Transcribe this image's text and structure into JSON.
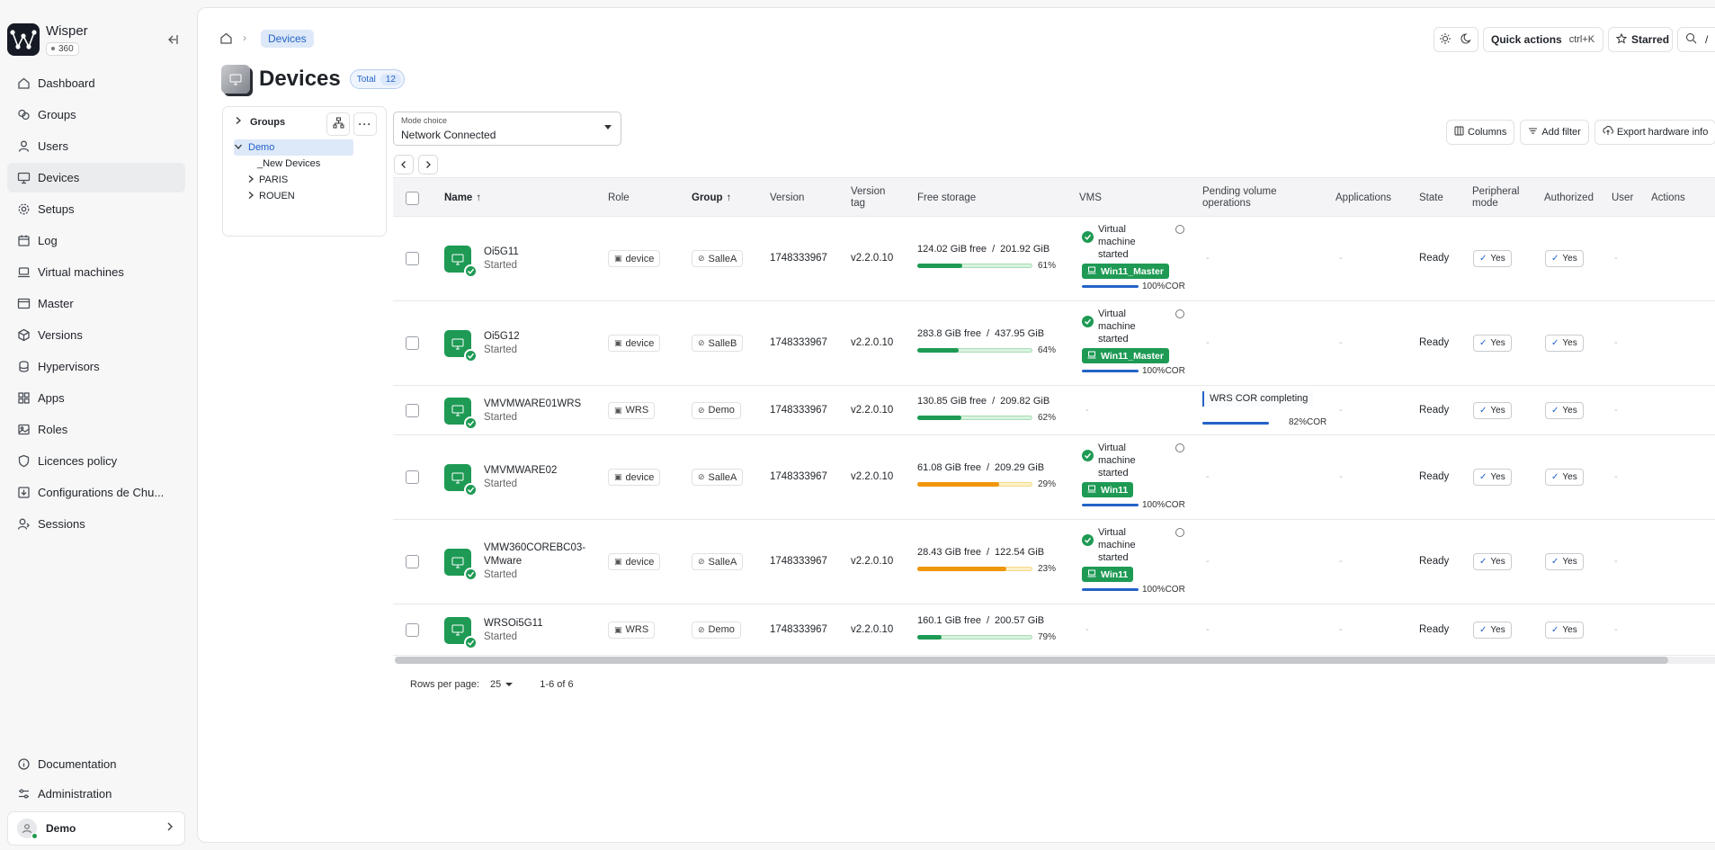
{
  "brand": {
    "name": "Wisper",
    "badge": "360"
  },
  "sidebar": {
    "items": [
      {
        "label": "Dashboard",
        "icon": "home-icon"
      },
      {
        "label": "Groups",
        "icon": "groups-icon"
      },
      {
        "label": "Users",
        "icon": "user-icon"
      },
      {
        "label": "Devices",
        "icon": "monitor-icon",
        "active": true
      },
      {
        "label": "Setups",
        "icon": "gear-icon"
      },
      {
        "label": "Log",
        "icon": "calendar-icon"
      },
      {
        "label": "Virtual machines",
        "icon": "laptop-icon"
      },
      {
        "label": "Master",
        "icon": "window-icon"
      },
      {
        "label": "Versions",
        "icon": "box-icon"
      },
      {
        "label": "Hypervisors",
        "icon": "server-icon"
      },
      {
        "label": "Apps",
        "icon": "apps-icon"
      },
      {
        "label": "Roles",
        "icon": "image-icon"
      },
      {
        "label": "Licences policy",
        "icon": "license-icon"
      },
      {
        "label": "Configurations de Chu...",
        "icon": "download-box-icon"
      },
      {
        "label": "Sessions",
        "icon": "user-session-icon"
      }
    ],
    "bottom": [
      {
        "label": "Documentation",
        "icon": "info-icon"
      },
      {
        "label": "Administration",
        "icon": "admin-icon"
      }
    ],
    "user": "Demo"
  },
  "breadcrumb": {
    "current": "Devices"
  },
  "topbar": {
    "quick_actions": "Quick actions",
    "shortcut": "ctrl+K",
    "starred": "Starred",
    "search_shortcut": "/"
  },
  "page": {
    "title": "Devices",
    "total_label": "Total",
    "total_count": "12"
  },
  "groups": {
    "header": "Groups",
    "tree": [
      {
        "label": "Demo",
        "selected": true,
        "expanded": true
      },
      {
        "label": "_New Devices"
      },
      {
        "label": "PARIS",
        "collapsed": true
      },
      {
        "label": "ROUEN",
        "collapsed": true
      }
    ]
  },
  "mode": {
    "label": "Mode choice",
    "value": "Network Connected"
  },
  "table_actions": {
    "columns": "Columns",
    "add_filter": "Add filter",
    "export": "Export hardware info"
  },
  "columns": [
    "Name",
    "Role",
    "Group",
    "Version",
    "Version tag",
    "Free storage",
    "VMS",
    "Pending volume operations",
    "Applications",
    "State",
    "Peripheral mode",
    "Authorized",
    "User",
    "Actions"
  ],
  "rows": [
    {
      "name": "Oi5G11",
      "status": "Started",
      "role": "device",
      "group": "SalleA",
      "version": "1748333967",
      "tag": "v2.2.0.10",
      "free": "124.02 GiB free",
      "total": "201.92 GiB",
      "pct": "61%",
      "used_fraction": 0.39,
      "bar_color": "#1e9a54",
      "vm_state": [
        "Virtual",
        "machine",
        "started"
      ],
      "vm_name": "Win11_Master",
      "vm_progress": "100%COR",
      "pending": "-",
      "apps": "-",
      "state": "Ready",
      "peripheral": "Yes",
      "authorized": "Yes",
      "user": "-"
    },
    {
      "name": "Oi5G12",
      "status": "Started",
      "role": "device",
      "group": "SalleB",
      "version": "1748333967",
      "tag": "v2.2.0.10",
      "free": "283.8 GiB free",
      "total": "437.95 GiB",
      "pct": "64%",
      "used_fraction": 0.36,
      "bar_color": "#1e9a54",
      "vm_state": [
        "Virtual",
        "machine",
        "started"
      ],
      "vm_name": "Win11_Master",
      "vm_progress": "100%COR",
      "pending": "-",
      "apps": "-",
      "state": "Ready",
      "peripheral": "Yes",
      "authorized": "Yes",
      "user": "-"
    },
    {
      "name": "VMVMWARE01WRS",
      "status": "Started",
      "role": "WRS",
      "group": "Demo",
      "version": "1748333967",
      "tag": "v2.2.0.10",
      "free": "130.85 GiB free",
      "total": "209.82 GiB",
      "pct": "62%",
      "used_fraction": 0.38,
      "bar_color": "#1e9a54",
      "vm_none": "-",
      "pending_op": "WRS COR completing",
      "pending_progress": "82%COR",
      "apps": "-",
      "state": "Ready",
      "peripheral": "Yes",
      "authorized": "Yes",
      "user": "-"
    },
    {
      "name": "VMVMWARE02",
      "status": "Started",
      "role": "device",
      "group": "SalleA",
      "version": "1748333967",
      "tag": "v2.2.0.10",
      "free": "61.08 GiB free",
      "total": "209.29 GiB",
      "pct": "29%",
      "used_fraction": 0.71,
      "bar_color": "#f0960a",
      "vm_state": [
        "Virtual",
        "machine",
        "started"
      ],
      "vm_name": "Win11",
      "vm_progress": "100%COR",
      "pending": "-",
      "apps": "-",
      "state": "Ready",
      "peripheral": "Yes",
      "authorized": "Yes",
      "user": "-"
    },
    {
      "name": "VMW360COREBC03-",
      "name2": "VMware",
      "status": "Started",
      "role": "device",
      "group": "SalleA",
      "version": "1748333967",
      "tag": "v2.2.0.10",
      "free": "28.43 GiB free",
      "total": "122.54 GiB",
      "pct": "23%",
      "used_fraction": 0.77,
      "bar_color": "#f0960a",
      "vm_state": [
        "Virtual",
        "machine",
        "started"
      ],
      "vm_name": "Win11",
      "vm_progress": "100%COR",
      "pending": "-",
      "apps": "-",
      "state": "Ready",
      "peripheral": "Yes",
      "authorized": "Yes",
      "user": "-"
    },
    {
      "name": "WRSOi5G11",
      "status": "Started",
      "role": "WRS",
      "group": "Demo",
      "version": "1748333967",
      "tag": "v2.2.0.10",
      "free": "160.1 GiB free",
      "total": "200.57 GiB",
      "pct": "79%",
      "used_fraction": 0.21,
      "bar_color": "#1e9a54",
      "vm_none": "-",
      "pending": "-",
      "apps": "-",
      "state": "Ready",
      "peripheral": "Yes",
      "authorized": "Yes",
      "user": "-"
    }
  ],
  "footer": {
    "rows_per_page_label": "Rows per page:",
    "rows_per_page": "25",
    "range": "1-6 of 6"
  },
  "separators": {
    "slash": "/",
    "chevron": "›"
  }
}
